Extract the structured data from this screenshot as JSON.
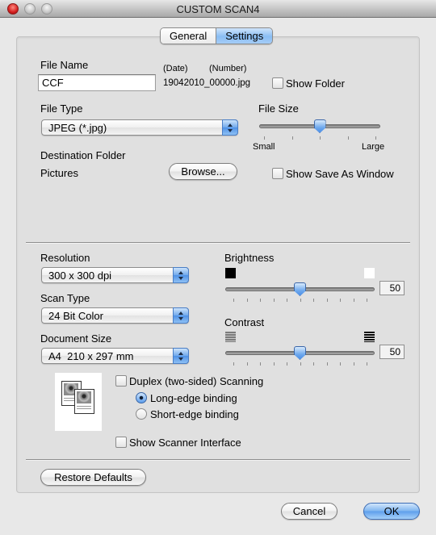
{
  "window": {
    "title": "CUSTOM SCAN4"
  },
  "tabs": [
    {
      "label": "General",
      "active": false
    },
    {
      "label": "Settings",
      "active": true
    }
  ],
  "file": {
    "name_label": "File Name",
    "name_value": "CCF",
    "date_label": "(Date)",
    "number_label": "(Number)",
    "filename_suffix": "19042010_00000.jpg",
    "show_folder_label": "Show Folder",
    "show_folder_checked": false,
    "type_label": "File Type",
    "type_value": "JPEG (*.jpg)",
    "size_label": "File Size",
    "size_min_label": "Small",
    "size_max_label": "Large",
    "size_ticks": 5,
    "size_position": 0.5,
    "destination_label": "Destination Folder",
    "destination_value": "Pictures",
    "browse_label": "Browse...",
    "show_save_as_label": "Show Save As Window",
    "show_save_as_checked": false
  },
  "scan": {
    "resolution_label": "Resolution",
    "resolution_value": "300 x 300 dpi",
    "scan_type_label": "Scan Type",
    "scan_type_value": "24 Bit Color",
    "document_size_label": "Document Size",
    "document_size_value": "A4  210 x 297 mm",
    "brightness_label": "Brightness",
    "brightness_value": "50",
    "brightness_fraction": 0.5,
    "contrast_label": "Contrast",
    "contrast_value": "50",
    "contrast_fraction": 0.5,
    "slider_ticks": 11,
    "duplex_label": "Duplex (two-sided) Scanning",
    "duplex_checked": false,
    "long_edge_label": "Long-edge binding",
    "long_edge_selected": true,
    "short_edge_label": "Short-edge binding",
    "short_edge_selected": false,
    "show_scanner_interface_label": "Show Scanner Interface",
    "show_scanner_interface_checked": false
  },
  "buttons": {
    "restore_defaults": "Restore Defaults",
    "cancel": "Cancel",
    "ok": "OK"
  }
}
